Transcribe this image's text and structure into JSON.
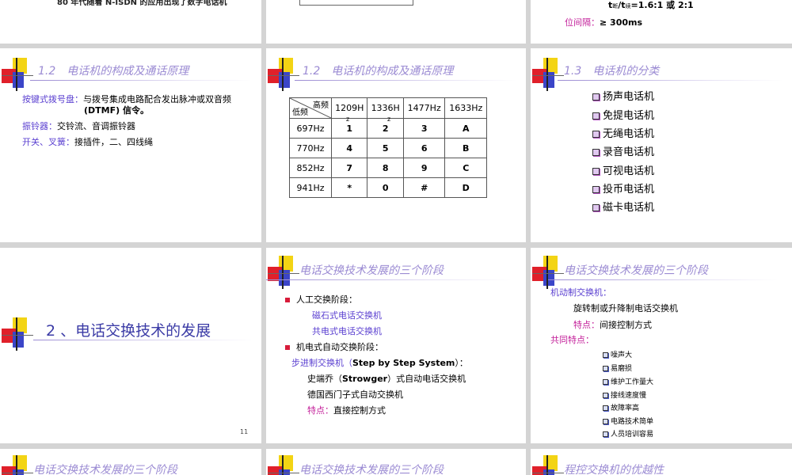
{
  "slide_top_left": {
    "text": "80 年代随着 N-ISDN 的应用出现了数字电话机"
  },
  "slide_top_right": {
    "ratio_prefix": "t",
    "ratio_sub1": "断",
    "ratio_mid": "/t",
    "ratio_sub2": "续",
    "ratio_value": "=1.6:1  或  2:1",
    "interval_label": "位间隔：",
    "interval_value": "≥ 300ms"
  },
  "slide_components": {
    "title": "1.2　电话机的构成及通话原理",
    "rows": [
      {
        "label": "按键式拨号盘：",
        "text": "与拨号集成电路配合发出脉冲或双音频",
        "text2": "(DTMF) 信令。"
      },
      {
        "label": "振铃器：",
        "text": "交铃流、音调振铃器"
      },
      {
        "label": "开关、叉簧：",
        "text": "接插件，二、四线绳"
      }
    ]
  },
  "slide_dtmf": {
    "title": "1.2　电话机的构成及通话原理",
    "corner_high": "高频",
    "corner_low": "低频",
    "col_headers": [
      "1209H",
      "1336H",
      "1477Hz",
      "1633Hz"
    ],
    "z_marks": [
      "z",
      "z"
    ],
    "rows": [
      {
        "freq": "697Hz",
        "keys": [
          "1",
          "2",
          "3",
          "A"
        ]
      },
      {
        "freq": "770Hz",
        "keys": [
          "4",
          "5",
          "6",
          "B"
        ]
      },
      {
        "freq": "852Hz",
        "keys": [
          "7",
          "8",
          "9",
          "C"
        ]
      },
      {
        "freq": "941Hz",
        "keys": [
          "*",
          "0",
          "#",
          "D"
        ]
      }
    ]
  },
  "slide_classification": {
    "title": "1.3　电话机的分类",
    "items": [
      "扬声电话机",
      "免提电话机",
      "无绳电话机",
      "录音电话机",
      "可视电话机",
      "投币电话机",
      "磁卡电话机"
    ]
  },
  "slide_section": {
    "title": "2 、电话交换技术的发展",
    "page_number": "11"
  },
  "slide_stages1": {
    "title": "电话交换技术发展的三个阶段",
    "stage1": "人工交换阶段：",
    "stage1_items": [
      "磁石式电话交换机",
      "共电式电话交换机"
    ],
    "stage2": "机电式自动交换阶段：",
    "step_label": "步进制交换机（",
    "step_en": "Step by Step System",
    "step_close": "）：",
    "strowger_pre": "史端乔（",
    "strowger_en": "Strowger",
    "strowger_post": "）式自动电话交换机",
    "siemens": "德国西门子式自动交换机",
    "feature_label": "特点：",
    "feature_text": "直接控制方式"
  },
  "slide_stages2": {
    "title": "电话交换技术发展的三个阶段",
    "machine_label": "机动制交换机：",
    "machine_text": "旋转制或升降制电话交换机",
    "feature_label": "特点：",
    "feature_text": "间接控制方式",
    "common_label": "共同特点：",
    "common_items": [
      "噪声大",
      "易磨损",
      "维护工作量大",
      "接线速度慢",
      "故障率高",
      "电路技术简单",
      "人员培训容易"
    ]
  },
  "slide_bottom": {
    "title_left": "电话交换技术发展的三个阶段",
    "title_mid": "电话交换技术发展的三个阶段",
    "title_right": "程控交换机的优越性"
  }
}
